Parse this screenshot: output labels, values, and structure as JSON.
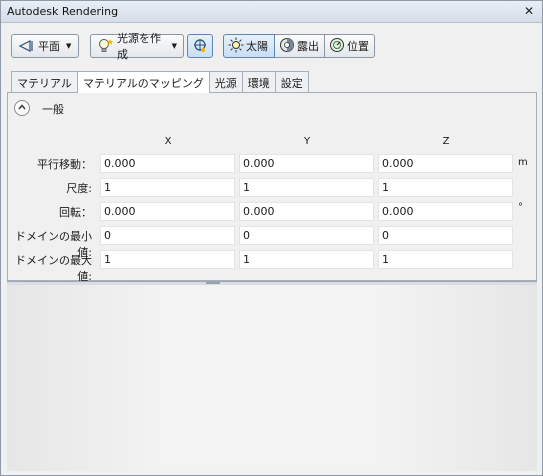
{
  "window": {
    "title": "Autodesk Rendering",
    "close_glyph": "✕"
  },
  "toolbar": {
    "plane_label": "平面",
    "create_light_label": "光源を作成",
    "sun_label": "太陽",
    "exposure_label": "露出",
    "location_label": "位置",
    "icons": [
      "plane-icon",
      "light-bulb-icon",
      "target-light-icon",
      "sun-icon",
      "exposure-icon",
      "location-icon"
    ]
  },
  "tabs": [
    "マテリアル",
    "マテリアルのマッピング",
    "光源",
    "環境",
    "設定"
  ],
  "active_tab": "マテリアルのマッピング",
  "section": {
    "title": "一般"
  },
  "grid": {
    "columns": [
      "X",
      "Y",
      "Z"
    ],
    "rows": [
      {
        "label": "平行移動：",
        "values": [
          "0.000",
          "0.000",
          "0.000"
        ],
        "unit": "m"
      },
      {
        "label": "尺度:",
        "values": [
          "1",
          "1",
          "1"
        ],
        "unit": ""
      },
      {
        "label": "回転：",
        "values": [
          "0.000",
          "0.000",
          "0.000"
        ],
        "unit": "°"
      },
      {
        "label": "ドメインの最小値:",
        "values": [
          "0",
          "0",
          "0"
        ],
        "unit": ""
      },
      {
        "label": "ドメインの最大値:",
        "values": [
          "1",
          "1",
          "1"
        ],
        "unit": ""
      }
    ]
  },
  "colors": {
    "accent": "#5f86b3",
    "panel_bg": "#f0f0f0"
  }
}
